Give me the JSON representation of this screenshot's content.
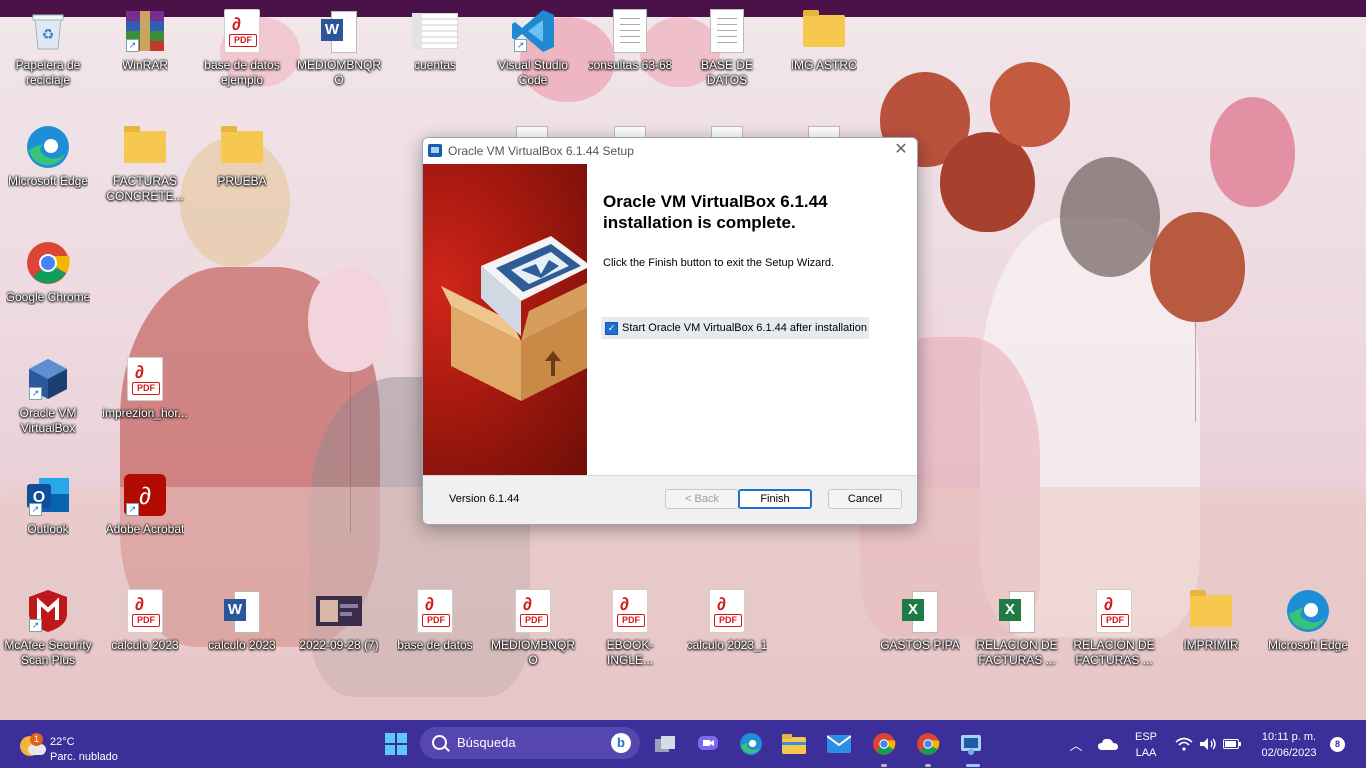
{
  "desktop": {
    "icons": [
      {
        "label": "Papelera de reciclaje",
        "icon": "recycle-bin-icon"
      },
      {
        "label": "WinRAR",
        "icon": "winrar-icon"
      },
      {
        "label": "base de datos ejemplo",
        "icon": "pdf-icon"
      },
      {
        "label": "MEDIOMBNQRO",
        "icon": "word-icon"
      },
      {
        "label": "cuentas",
        "icon": "spreadsheet-thumbnail-icon"
      },
      {
        "label": "Visual Studio Code",
        "icon": "vscode-icon"
      },
      {
        "label": "consultas 63-68",
        "icon": "text-file-icon"
      },
      {
        "label": "BASE DE DATOS",
        "icon": "text-file-icon"
      },
      {
        "label": "IMG ASTRO",
        "icon": "folder-icon"
      },
      {
        "label": "Microsoft Edge",
        "icon": "edge-icon"
      },
      {
        "label": "FACTURAS CONCRETE...",
        "icon": "folder-icon"
      },
      {
        "label": "PRUEBA",
        "icon": "folder-icon"
      },
      {
        "label": "Google Chrome",
        "icon": "chrome-icon"
      },
      {
        "label": "Oracle VM VirtualBox",
        "icon": "virtualbox-icon"
      },
      {
        "label": "imprezion_hor...",
        "icon": "pdf-icon"
      },
      {
        "label": "Outlook",
        "icon": "outlook-icon"
      },
      {
        "label": "Adobe Acrobat",
        "icon": "acrobat-icon"
      },
      {
        "label": "McAfee Security Scan Plus",
        "icon": "mcafee-icon"
      },
      {
        "label": "calculo 2023",
        "icon": "pdf-icon"
      },
      {
        "label": "calculo 2023",
        "icon": "word-icon"
      },
      {
        "label": "2022-09-28 (7)",
        "icon": "image-icon"
      },
      {
        "label": "base de datos",
        "icon": "pdf-icon"
      },
      {
        "label": "MEDIOMBNQRO",
        "icon": "pdf-icon"
      },
      {
        "label": "EBOOK-INGLE...",
        "icon": "pdf-icon"
      },
      {
        "label": "calculo 2023_1",
        "icon": "pdf-icon"
      },
      {
        "label": "GASTOS PIPA",
        "icon": "excel-icon"
      },
      {
        "label": "RELACION DE FACTURAS ...",
        "icon": "excel-icon"
      },
      {
        "label": "RELACION DE FACTURAS ...",
        "icon": "pdf-icon"
      },
      {
        "label": "IMPRIMIR",
        "icon": "folder-icon"
      },
      {
        "label": "Microsoft Edge",
        "icon": "edge-icon"
      }
    ],
    "pdf_tag": "PDF"
  },
  "dialog": {
    "title": "Oracle VM VirtualBox 6.1.44 Setup",
    "heading": "Oracle VM VirtualBox 6.1.44 installation is complete.",
    "subtext": "Click the Finish button to exit the Setup Wizard.",
    "checkbox_label": "Start Oracle VM VirtualBox 6.1.44 after installation",
    "checkbox_checked": true,
    "version": "Version 6.1.44",
    "back_label": "< Back",
    "finish_label": "Finish",
    "cancel_label": "Cancel",
    "close_glyph": "✕"
  },
  "taskbar": {
    "weather_temp": "22°C",
    "weather_condition": "Parc. nublado",
    "weather_badge": "1",
    "search_placeholder": "Búsqueda",
    "language": "ESP",
    "keyboard": "LAA",
    "time": "10:11 p. m.",
    "date": "02/06/2023",
    "notification_count": "8",
    "accent": "#3d2f9a"
  }
}
